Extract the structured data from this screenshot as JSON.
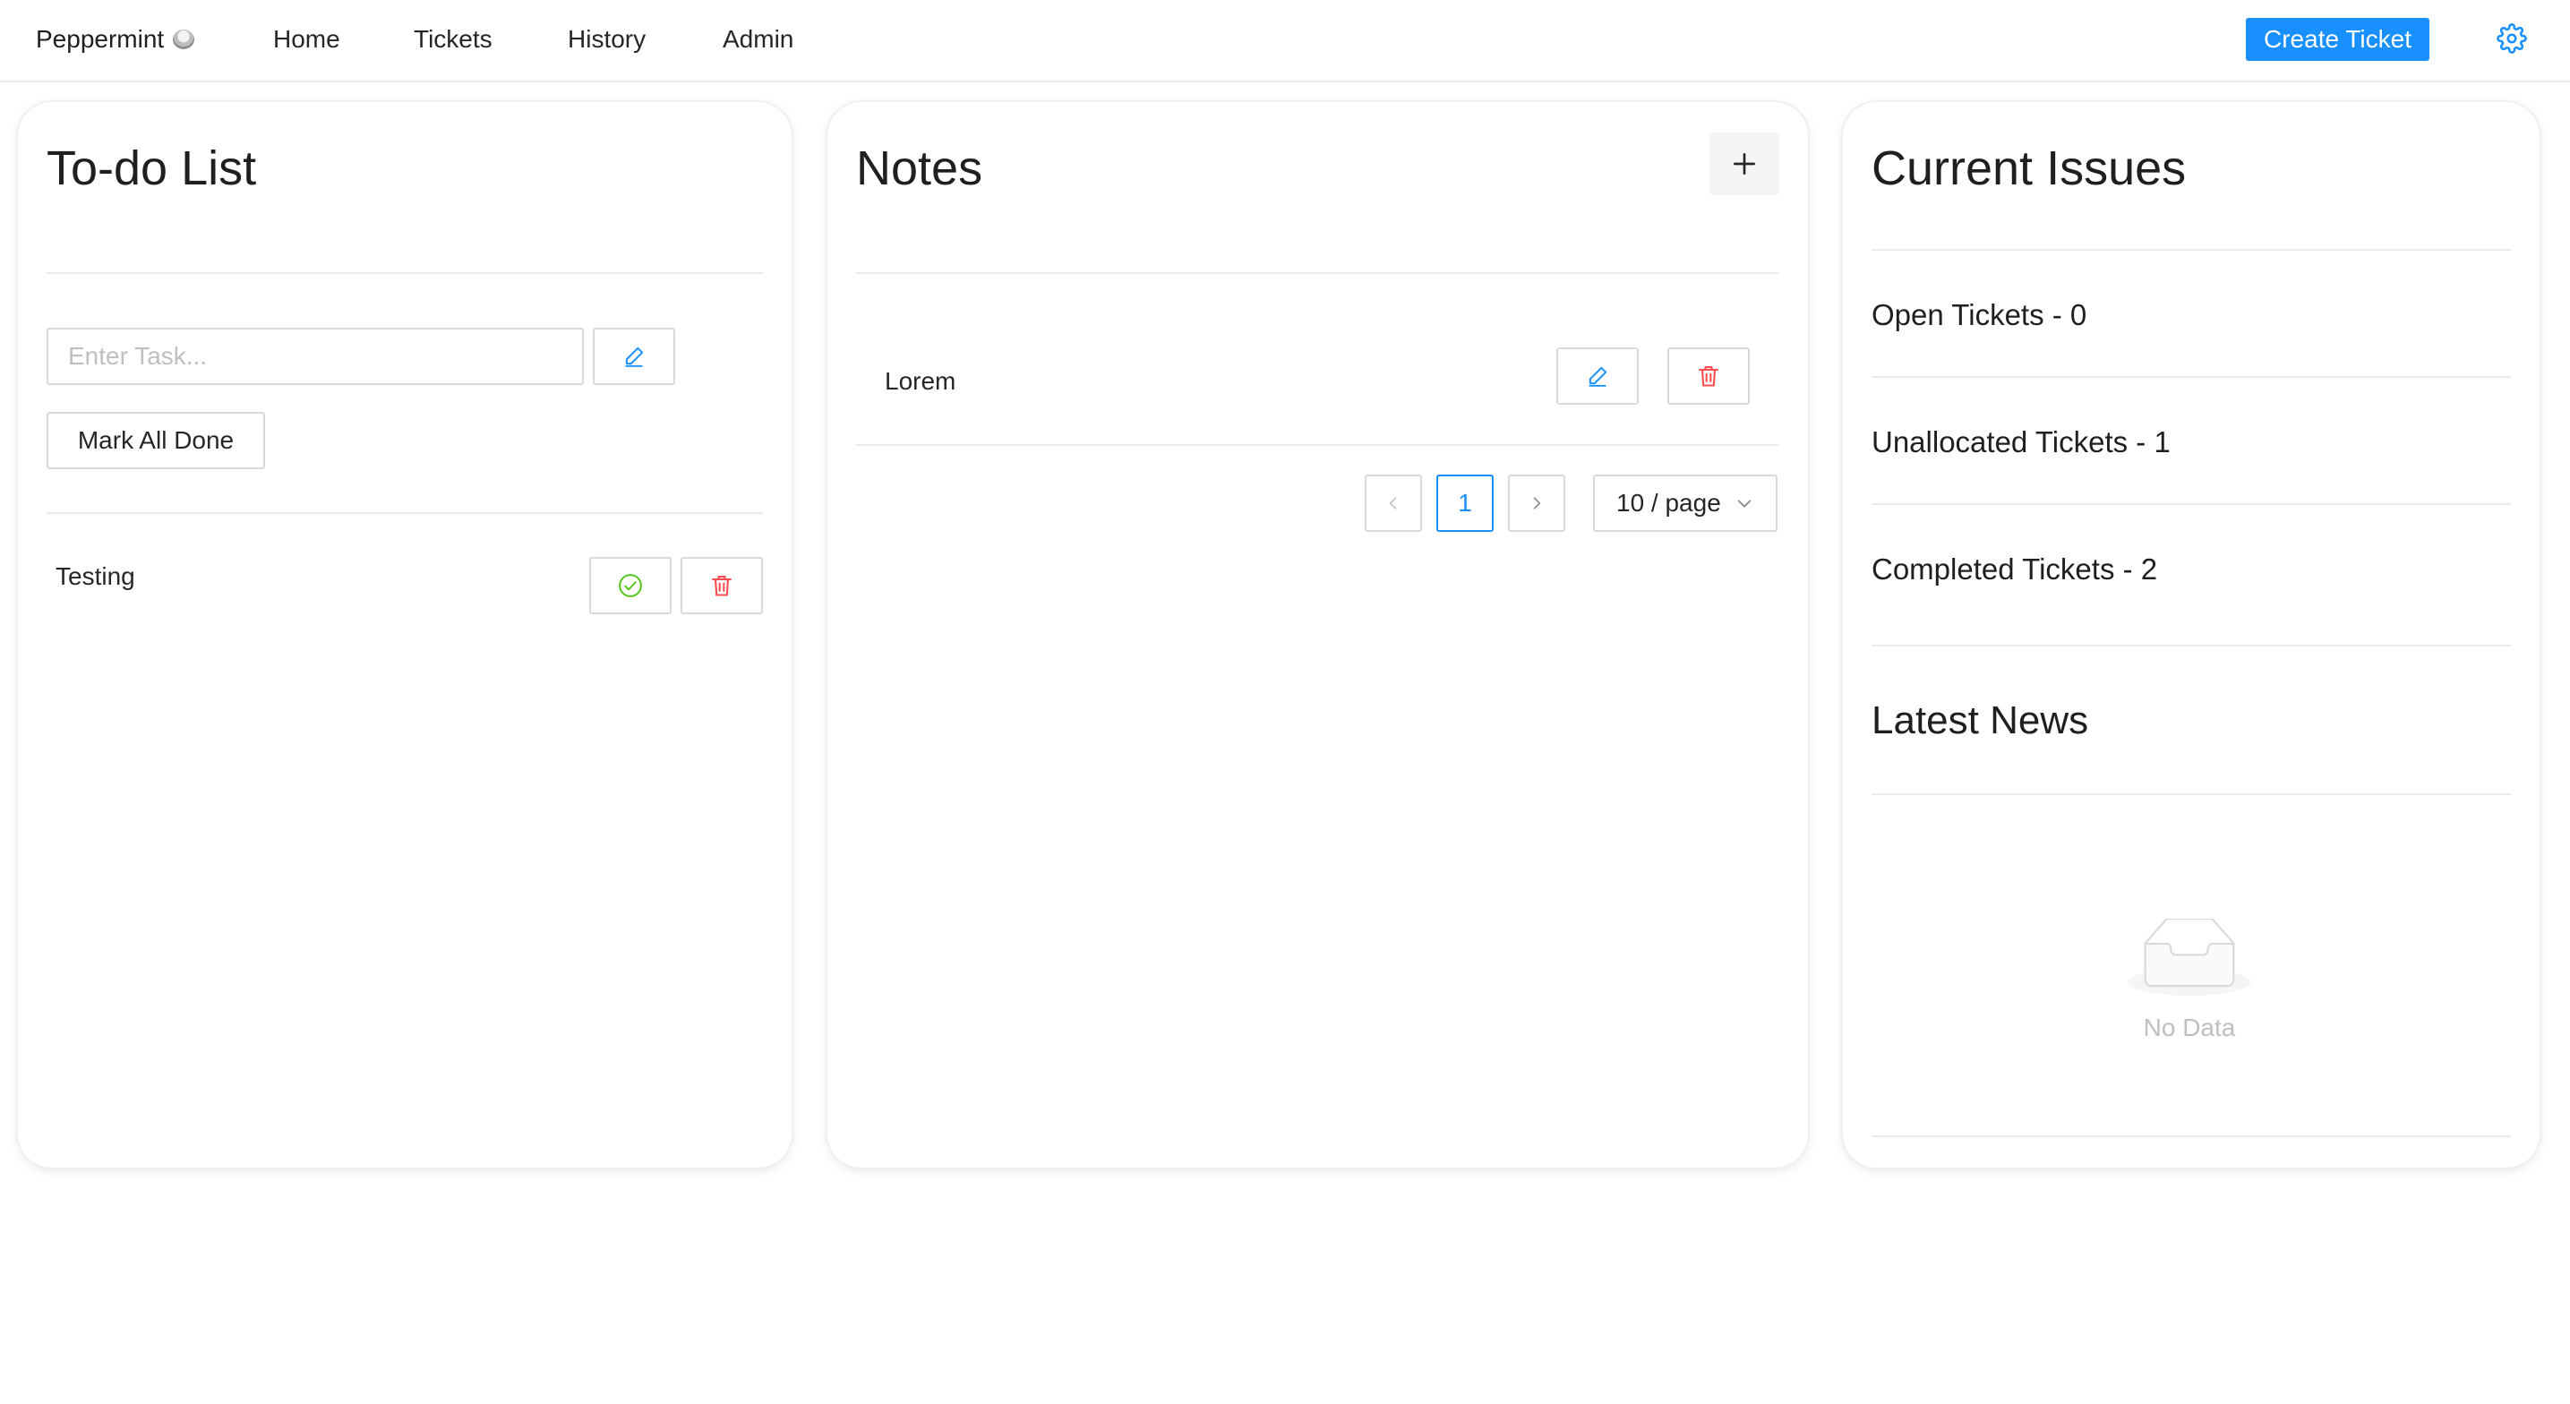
{
  "nav": {
    "brand": "Peppermint",
    "items": [
      {
        "label": "Home"
      },
      {
        "label": "Tickets"
      },
      {
        "label": "History"
      },
      {
        "label": "Admin"
      }
    ],
    "create_ticket_label": "Create Ticket"
  },
  "todo": {
    "title": "To-do List",
    "input_placeholder": "Enter Task...",
    "mark_all_done_label": "Mark All Done",
    "tasks": [
      {
        "text": "Testing"
      }
    ]
  },
  "notes": {
    "title": "Notes",
    "items": [
      {
        "text": "Lorem"
      }
    ],
    "pagination": {
      "current_page": "1",
      "page_size": "10 / page"
    }
  },
  "issues": {
    "title": "Current Issues",
    "stats": [
      {
        "label": "Open Tickets - 0"
      },
      {
        "label": "Unallocated Tickets - 1"
      },
      {
        "label": "Completed Tickets - 2"
      }
    ],
    "news_title": "Latest News",
    "empty_text": "No Data"
  },
  "colors": {
    "primary": "#1890ff",
    "success": "#52c41a",
    "danger": "#ff4d4f"
  },
  "icons": {
    "brand": "peppermint-logo-icon",
    "settings": "gear-icon",
    "add_note": "plus-icon",
    "edit": "pencil-icon",
    "complete": "check-circle-icon",
    "delete": "trash-icon",
    "prev": "chevron-left-icon",
    "next": "chevron-right-icon",
    "dropdown": "chevron-down-icon",
    "empty": "empty-inbox-icon"
  }
}
